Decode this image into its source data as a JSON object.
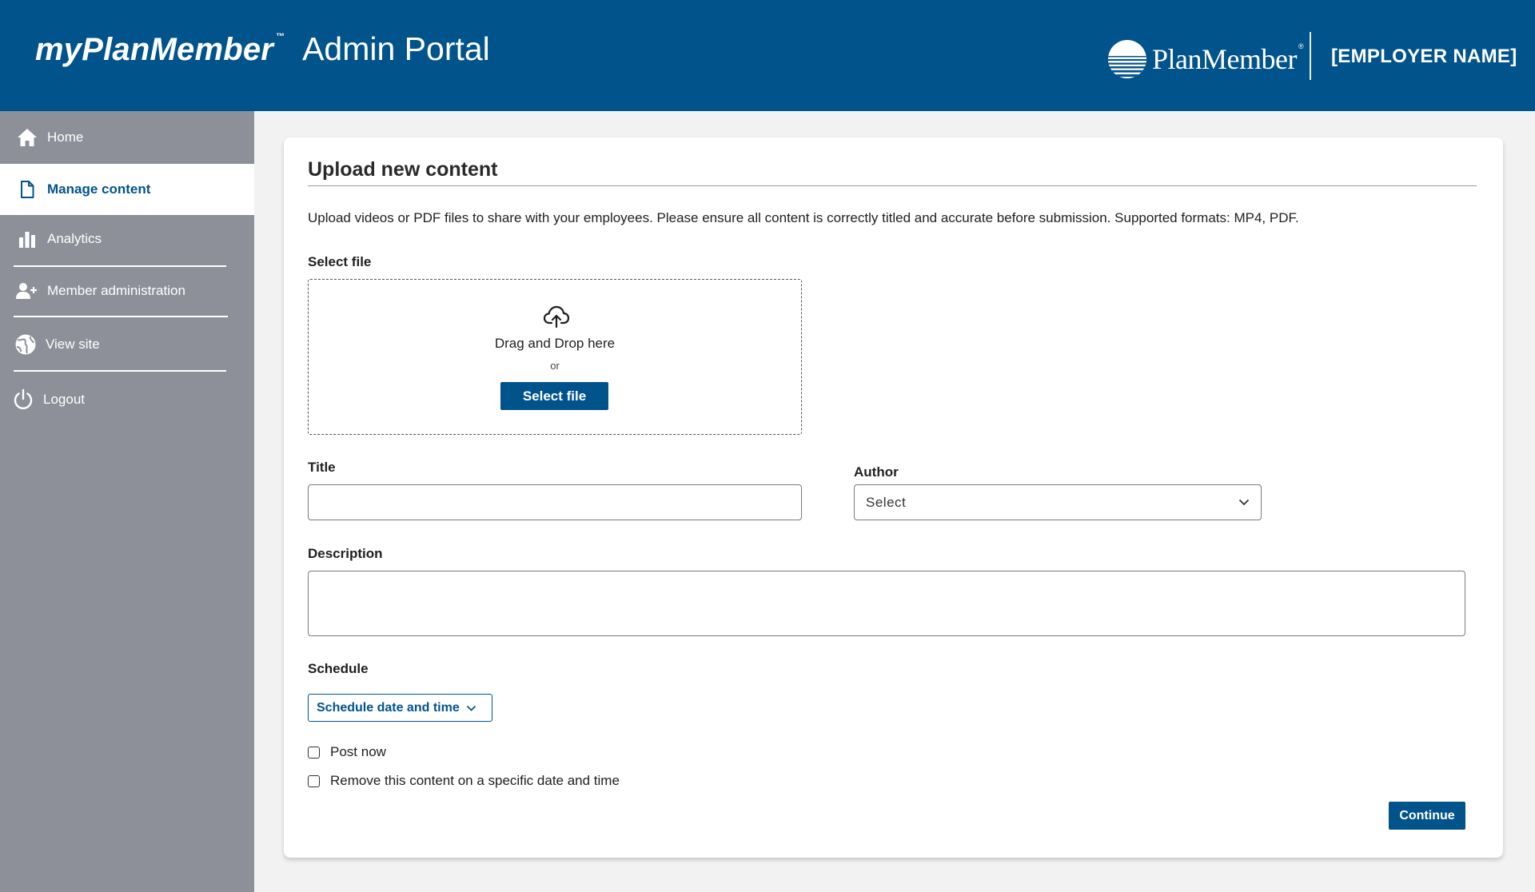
{
  "header": {
    "brand_name": "myPlanMember",
    "brand_tm": "™",
    "portal_title": "Admin Portal",
    "logo_text": "PlanMember",
    "logo_reg": "®",
    "employer_name": "[EMPLOYER NAME]"
  },
  "sidebar": {
    "items": [
      {
        "label": "Home",
        "icon": "home-icon"
      },
      {
        "label": "Manage content",
        "icon": "document-icon",
        "active": true
      },
      {
        "label": "Analytics",
        "icon": "bar-chart-icon"
      },
      {
        "label": "Member administration",
        "icon": "add-user-icon"
      },
      {
        "label": "View site",
        "icon": "globe-icon"
      },
      {
        "label": "Logout",
        "icon": "power-icon"
      }
    ]
  },
  "form": {
    "title": "Upload new content",
    "intro": "Upload videos or PDF files to share with your employees. Please ensure all content is correctly titled and accurate before submission. Supported formats: MP4, PDF.",
    "select_file_label": "Select file",
    "dropzone": {
      "drag_text": "Drag and Drop here",
      "or_text": "or",
      "button_label": "Select file",
      "icon": "cloud-upload-icon"
    },
    "title_label": "Title",
    "title_value": "",
    "author_label": "Author",
    "author_value": "Select",
    "description_label": "Description",
    "description_value": "",
    "schedule_label": "Schedule",
    "schedule_button": "Schedule date and time",
    "post_now_label": "Post now",
    "post_now_checked": false,
    "remove_label": "Remove this content on a specific date and time",
    "remove_checked": false,
    "continue_label": "Continue"
  },
  "colors": {
    "brand_blue": "#01538b",
    "sidebar_gray": "#8d9099",
    "page_bg": "#f2f2f2"
  }
}
